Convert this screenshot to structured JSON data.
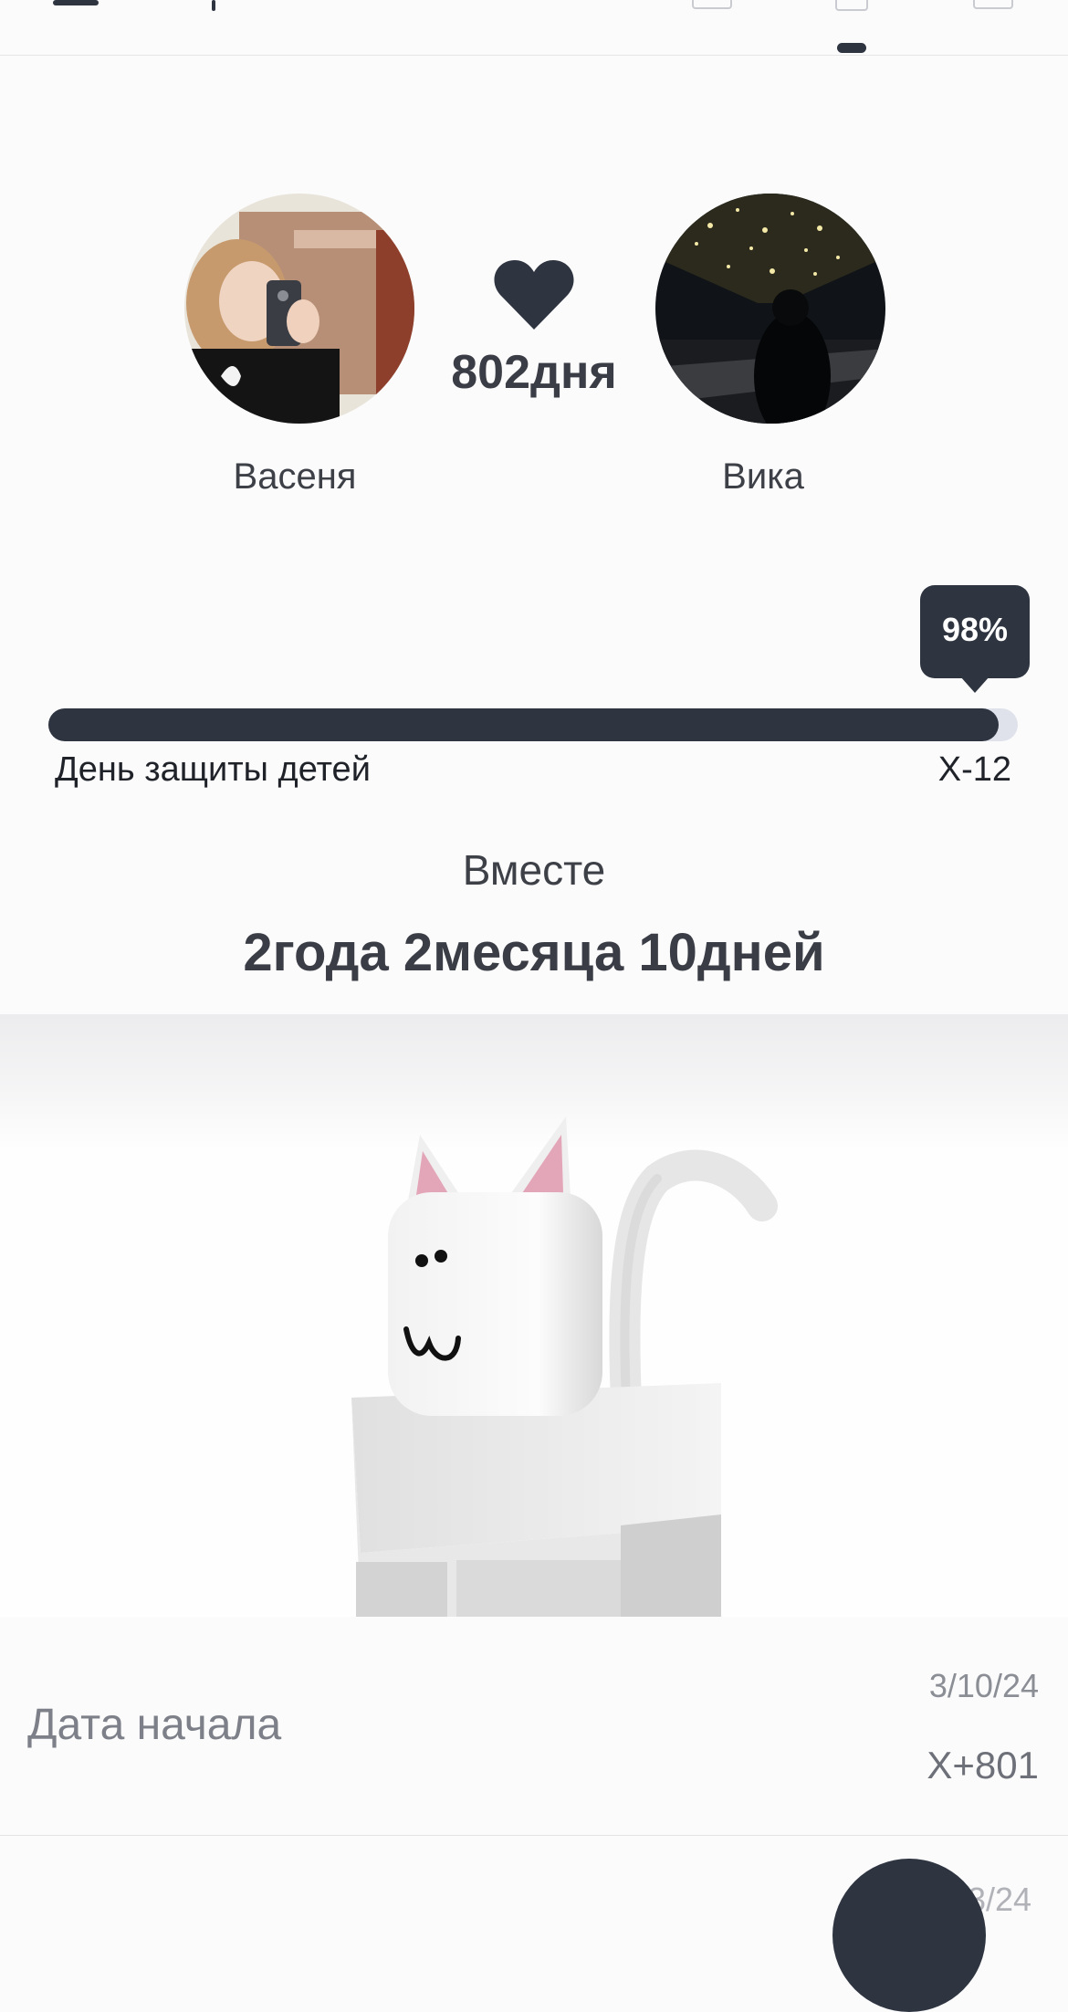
{
  "header": {
    "menu_icon": "hamburger-menu-icon",
    "tabs": [
      "list-tab-icon",
      "grid-tab-icon",
      "calendar-tab-icon"
    ],
    "active_tab": 1
  },
  "couple": {
    "left_name": "Васеня",
    "right_name": "Вика",
    "heart_icon": "heart-icon",
    "days_count": "802дня"
  },
  "milestone": {
    "progress_percent": 98,
    "progress_label": "98%",
    "event_name": "День защиты детей",
    "countdown": "X-12"
  },
  "together": {
    "label": "Вместе",
    "duration": "2года 2месяца 10дней"
  },
  "start": {
    "label": "Дата начала",
    "date": "3/10/24",
    "count": "X+801"
  },
  "next_item": {
    "date_fragment": "3/24"
  },
  "colors": {
    "accent": "#2e3440",
    "track": "#dfe2ea",
    "background": "#fbfbfc"
  }
}
